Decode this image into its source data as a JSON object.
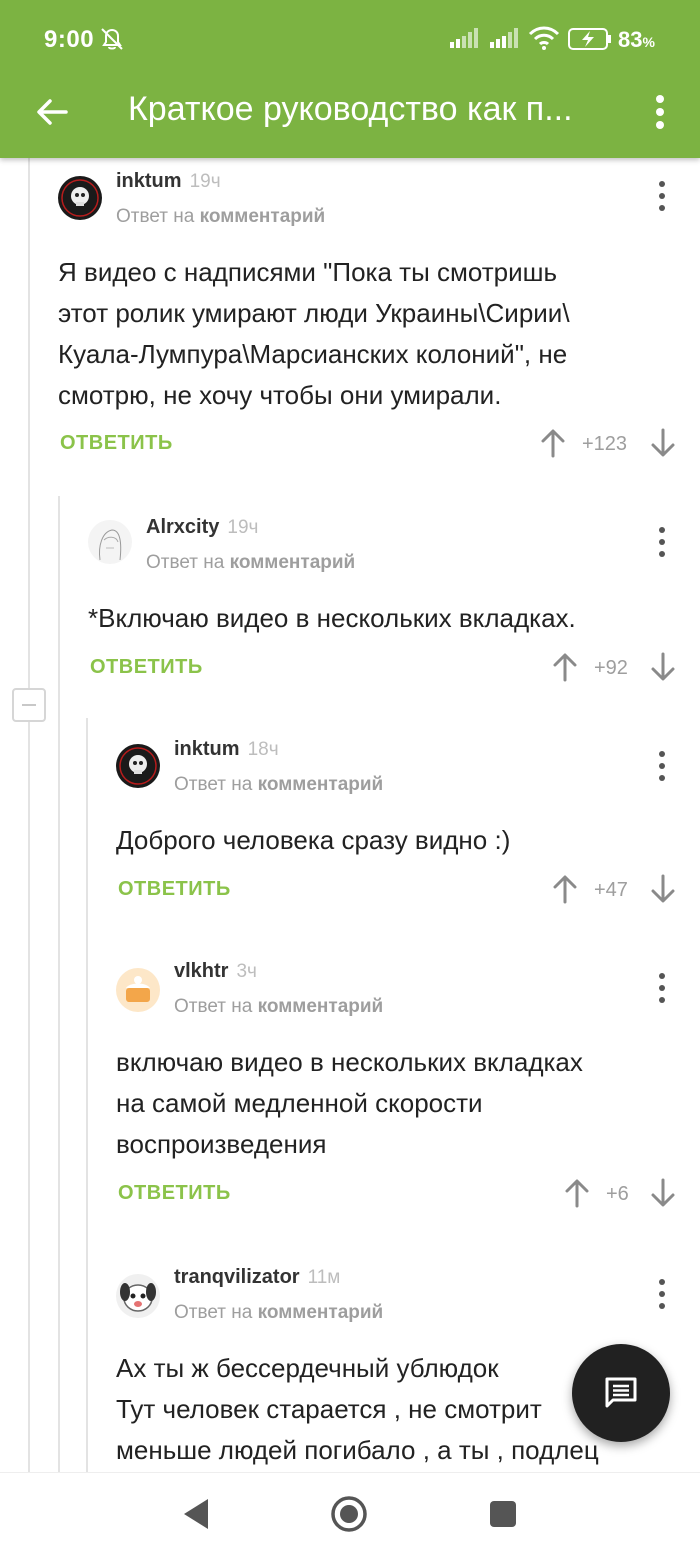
{
  "status_bar": {
    "time": "9:00",
    "battery": "83",
    "battery_unit": "%"
  },
  "app_bar": {
    "title": "Краткое руководство как п..."
  },
  "comments": [
    {
      "user": "inktum",
      "time": "19ч",
      "reply_prefix": "Ответ на",
      "reply_target": "комментарий",
      "text": "Я видео с надписями \"Пока ты смотришь\nэтот ролик умирают люди Украины\\Сирии\\\nКуала-Лумпура\\Марсианских колоний\", не\nсмотрю, не хочу чтобы они умирали.",
      "reply_label": "ОТВЕТИТЬ",
      "score": "+123"
    },
    {
      "user": "Alrxcity",
      "time": "19ч",
      "reply_prefix": "Ответ на",
      "reply_target": "комментарий",
      "text": "*Включаю видео в нескольких вкладках.",
      "reply_label": "ОТВЕТИТЬ",
      "score": "+92"
    },
    {
      "user": "inktum",
      "time": "18ч",
      "reply_prefix": "Ответ на",
      "reply_target": "комментарий",
      "text": "Доброго человека сразу видно :)",
      "reply_label": "ОТВЕТИТЬ",
      "score": "+47"
    },
    {
      "user": "vlkhtr",
      "time": "3ч",
      "reply_prefix": "Ответ на",
      "reply_target": "комментарий",
      "text": "включаю видео в нескольких вкладках\nна самой медленной скорости\nвоспроизведения",
      "reply_label": "ОТВЕТИТЬ",
      "score": "+6"
    },
    {
      "user": "tranqvilizator",
      "time": "11м",
      "reply_prefix": "Ответ на",
      "reply_target": "комментарий",
      "text": "Ах ты ж бессердечный ублюдок\nТут человек старается , не смотрит\nменьше людей погибало , а ты , подлец",
      "reply_label": "",
      "score": ""
    }
  ],
  "icons": {
    "back": "arrow-left-icon",
    "more": "more-vert-icon",
    "upvote": "arrow-up-icon",
    "downvote": "arrow-down-icon",
    "fab": "comment-icon",
    "collapse": "collapse-thread-icon"
  },
  "colors": {
    "accent": "#7cb342",
    "reply": "#8bc34a",
    "fab": "#212121"
  }
}
